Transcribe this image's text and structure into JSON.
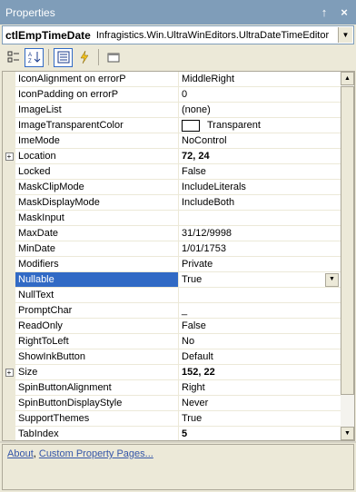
{
  "window": {
    "title": "Properties",
    "pin_glyph": "↑",
    "close_glyph": "×"
  },
  "object_selector": {
    "name": "ctlEmpTimeDate",
    "type": "Infragistics.Win.UltraWinEditors.UltraDateTimeEditor"
  },
  "toolbar": {
    "buttons": [
      {
        "name": "categorized",
        "icon": "categorized-icon",
        "active": false
      },
      {
        "name": "alphabetical",
        "icon": "alphabetical-sort-icon",
        "active": true
      },
      {
        "name": "properties",
        "icon": "properties-icon",
        "active": true
      },
      {
        "name": "events",
        "icon": "lightning-icon",
        "active": false
      },
      {
        "name": "property-pages",
        "icon": "property-pages-icon",
        "active": false
      }
    ]
  },
  "properties": [
    {
      "name": "IconAlignment on errorP",
      "value": "MiddleRight"
    },
    {
      "name": "IconPadding on errorP",
      "value": "0"
    },
    {
      "name": "ImageList",
      "value": "(none)"
    },
    {
      "name": "ImageTransparentColor",
      "value": "Transparent",
      "swatch": true
    },
    {
      "name": "ImeMode",
      "value": "NoControl"
    },
    {
      "name": "Location",
      "value": "72, 24",
      "expandable": true,
      "bold": true
    },
    {
      "name": "Locked",
      "value": "False"
    },
    {
      "name": "MaskClipMode",
      "value": "IncludeLiterals"
    },
    {
      "name": "MaskDisplayMode",
      "value": "IncludeBoth"
    },
    {
      "name": "MaskInput",
      "value": ""
    },
    {
      "name": "MaxDate",
      "value": "31/12/9998"
    },
    {
      "name": "MinDate",
      "value": "1/01/1753"
    },
    {
      "name": "Modifiers",
      "value": "Private"
    },
    {
      "name": "Nullable",
      "value": "True",
      "selected": true
    },
    {
      "name": "NullText",
      "value": ""
    },
    {
      "name": "PromptChar",
      "value": "_"
    },
    {
      "name": "ReadOnly",
      "value": "False"
    },
    {
      "name": "RightToLeft",
      "value": "No"
    },
    {
      "name": "ShowInkButton",
      "value": "Default"
    },
    {
      "name": "Size",
      "value": "152, 22",
      "expandable": true,
      "bold": true
    },
    {
      "name": "SpinButtonAlignment",
      "value": "Right"
    },
    {
      "name": "SpinButtonDisplayStyle",
      "value": "Never"
    },
    {
      "name": "SupportThemes",
      "value": "True"
    },
    {
      "name": "TabIndex",
      "value": "5",
      "bold": true
    }
  ],
  "footer": {
    "link1": "About",
    "separator": ", ",
    "link2": "Custom Property Pages..."
  },
  "colors": {
    "titlebar": "#7f9db9",
    "selection": "#316ac5",
    "panel": "#ece9d8"
  }
}
